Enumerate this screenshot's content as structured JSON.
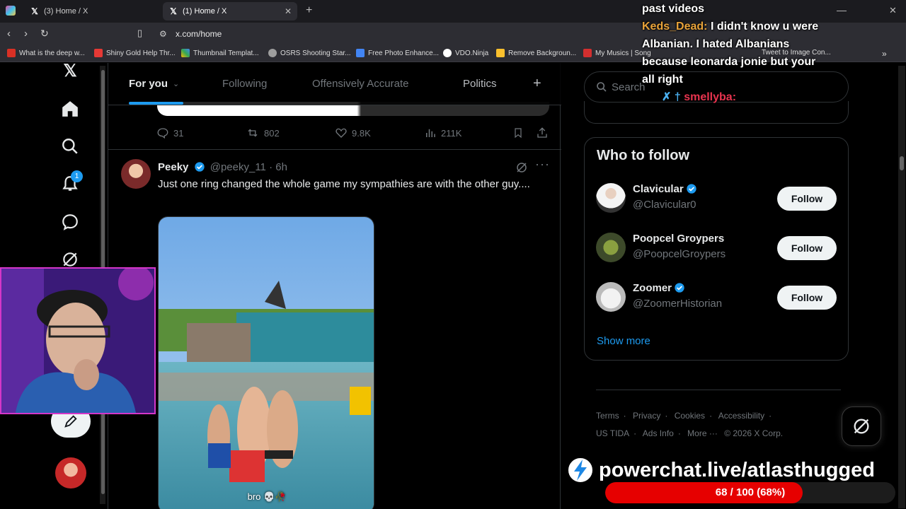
{
  "browser": {
    "tabs": [
      {
        "title": "(3) Home / X"
      },
      {
        "title": "(1) Home / X"
      }
    ],
    "url": "x.com/home",
    "bookmarks": [
      {
        "label": "What is the deep w...",
        "color": "#d93025"
      },
      {
        "label": "Shiny Gold Help Thr...",
        "color": "#e53935"
      },
      {
        "label": "Thumbnail Templat...",
        "color": "#fbbc04"
      },
      {
        "label": "OSRS Shooting Star...",
        "color": "#9e9e9e"
      },
      {
        "label": "Free Photo Enhance...",
        "color": "#4285f4"
      },
      {
        "label": "VDO.Ninja",
        "color": "#ffffff"
      },
      {
        "label": "Remove Backgroun...",
        "color": "#fbc02d"
      },
      {
        "label": "My Musics | Song",
        "color": "#d32f2f"
      },
      {
        "label": "Tweet to Image Con...",
        "color": "#90caf9"
      }
    ]
  },
  "feed": {
    "tabs": [
      "For you",
      "Following",
      "Offensively Accurate",
      "Politics"
    ],
    "prev_post_stats": {
      "replies": "31",
      "reposts": "802",
      "likes": "9.8K",
      "views": "211K"
    },
    "post": {
      "name": "Peeky",
      "handle": "@peeky_11",
      "time": "· 6h",
      "text": "Just one ring changed the whole game my sympathies are with the other guy....",
      "media_caption": "bro 💀🥀"
    }
  },
  "sidebar": {
    "search_placeholder": "Search",
    "who_to_follow_title": "Who to follow",
    "suggestions": [
      {
        "name": "Clavicular",
        "handle": "@Clavicular0",
        "verified": true,
        "button": "Follow"
      },
      {
        "name": "Poopcel Groypers",
        "handle": "@PoopcelGroypers",
        "verified": false,
        "button": "Follow"
      },
      {
        "name": "Zoomer",
        "handle": "@ZoomerHistorian",
        "verified": true,
        "button": "Follow"
      }
    ],
    "show_more": "Show more",
    "footer": [
      "Terms",
      "Privacy",
      "Cookies",
      "Accessibility",
      "US TIDA",
      "Ads Info",
      "More ···",
      "© 2026 X Corp."
    ],
    "notif_badge": "1"
  },
  "overlay": {
    "chat_line1": "past videos",
    "chat_user1": "Keds_Dead:",
    "chat_msg1": "I didn't know u were Albanian. I hated Albanians because leonarda jonie but your all right",
    "chat_user2": "smellyba:",
    "powerchat_url": "powerchat.live/atlasthugged",
    "progress_text": "68 / 100 (68%)",
    "progress_fraction": 0.68
  },
  "colors": {
    "accent": "#1d9bf0",
    "progress": "#e60000"
  }
}
